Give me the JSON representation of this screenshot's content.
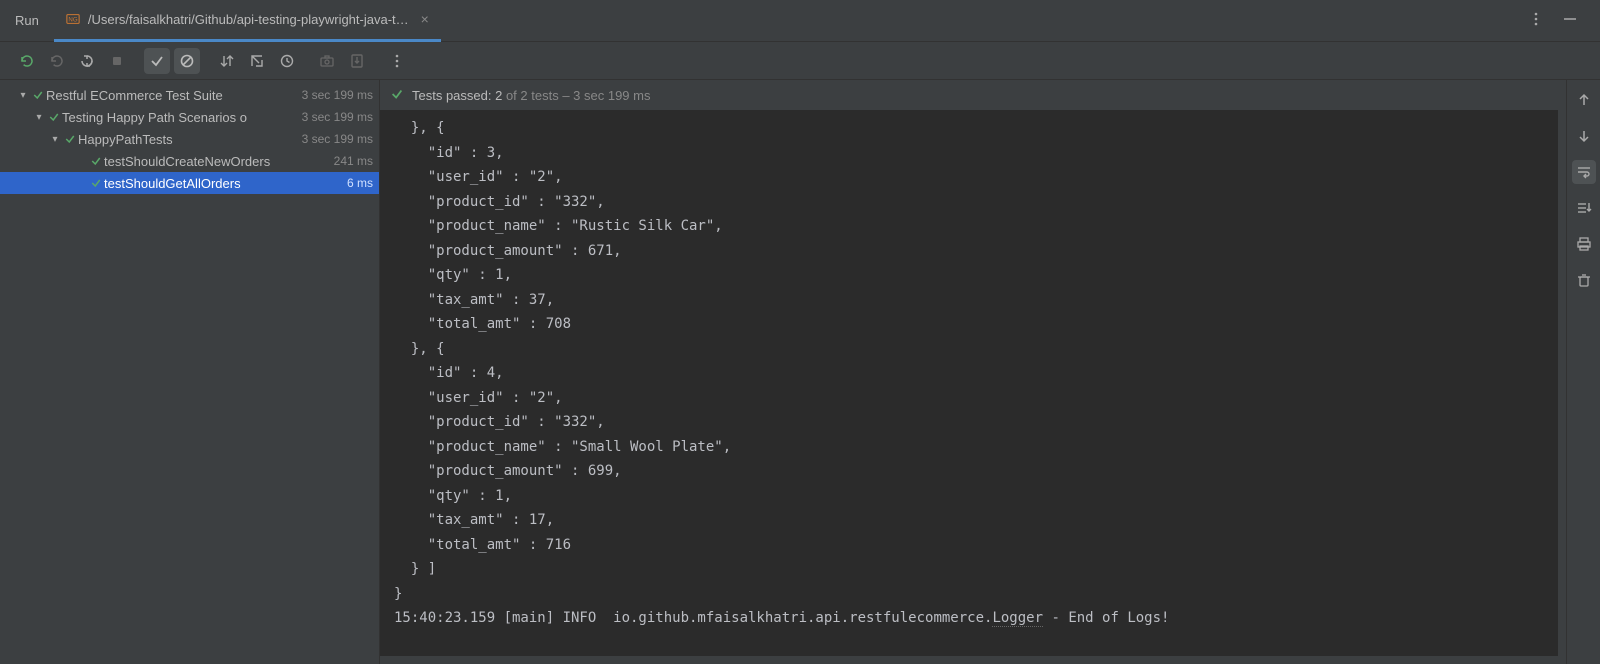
{
  "topbar": {
    "run_label": "Run",
    "tab_title": "/Users/faisalkhatri/Github/api-testing-playwright-java-t…"
  },
  "tree": [
    {
      "indent": 1,
      "chevron": "▾",
      "name": "Restful ECommerce Test Suite",
      "time": "3 sec 199 ms",
      "selected": false
    },
    {
      "indent": 2,
      "chevron": "▾",
      "name": "Testing Happy Path Scenarios o",
      "time": "3 sec 199 ms",
      "selected": false
    },
    {
      "indent": 3,
      "chevron": "▾",
      "name": "HappyPathTests",
      "time": "3 sec 199 ms",
      "selected": false
    },
    {
      "indent": 4,
      "chevron": "",
      "name": "testShouldCreateNewOrders",
      "time": "241 ms",
      "selected": false
    },
    {
      "indent": 4,
      "chevron": "",
      "name": "testShouldGetAllOrders",
      "time": "6 ms",
      "selected": true
    }
  ],
  "results_header": {
    "passed_label": "Tests passed: ",
    "passed_count": "2",
    "of_label": " of 2 tests – 3 sec 199 ms"
  },
  "console_text": "  }, {\n    \"id\" : 3,\n    \"user_id\" : \"2\",\n    \"product_id\" : \"332\",\n    \"product_name\" : \"Rustic Silk Car\",\n    \"product_amount\" : 671,\n    \"qty\" : 1,\n    \"tax_amt\" : 37,\n    \"total_amt\" : 708\n  }, {\n    \"id\" : 4,\n    \"user_id\" : \"2\",\n    \"product_id\" : \"332\",\n    \"product_name\" : \"Small Wool Plate\",\n    \"product_amount\" : 699,\n    \"qty\" : 1,\n    \"tax_amt\" : 17,\n    \"total_amt\" : 716\n  } ]\n}",
  "log_line": {
    "prefix": "15:40:23.159 [main] INFO  io.github.mfaisalkhatri.api.restfulecommerce.",
    "class": "Logger",
    "suffix": " - End of Logs!"
  }
}
